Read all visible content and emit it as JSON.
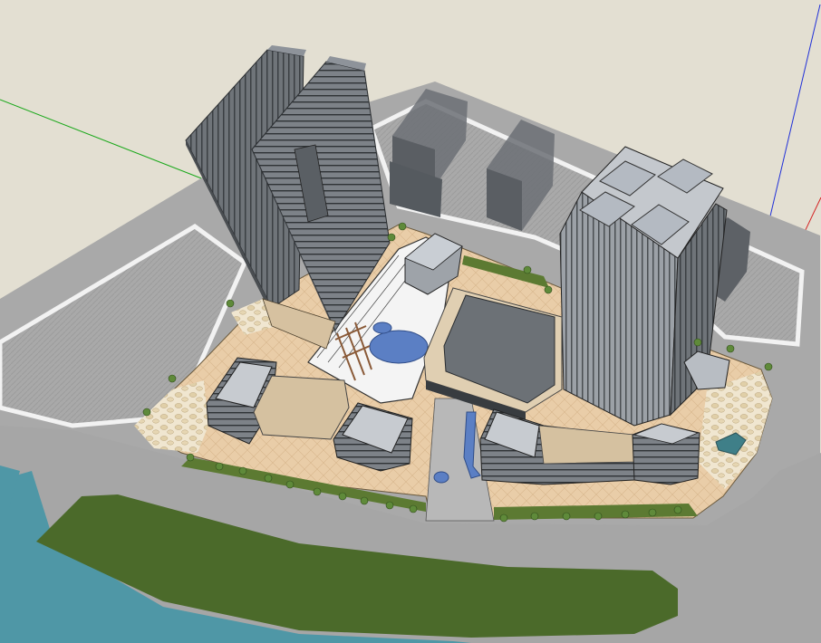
{
  "viewport": {
    "label": "",
    "background_color": "#e3dfd2"
  },
  "axes": {
    "red": "#d42020",
    "green": "#1aa81a",
    "blue": "#2030d8"
  },
  "colors": {
    "river": "#4f97a6",
    "grass": "#4b6a2a",
    "road": "#a8a8a8",
    "plaza_paving": "#e7c9a3",
    "roof_beige": "#d8c7ad",
    "glass_dark": "#6f7479",
    "glass_light": "#b4bac2",
    "pool_blue": "#5b7fc4",
    "facade_grey": "#8a8f95"
  },
  "scene": {
    "towers": [
      "west-tower-a",
      "west-tower-b",
      "east-tower"
    ],
    "context_blocks": [
      "context-block-1",
      "context-block-2",
      "context-block-3"
    ],
    "podiums": [
      "west-podium",
      "central-podium",
      "south-podium",
      "southeast-podium"
    ]
  }
}
